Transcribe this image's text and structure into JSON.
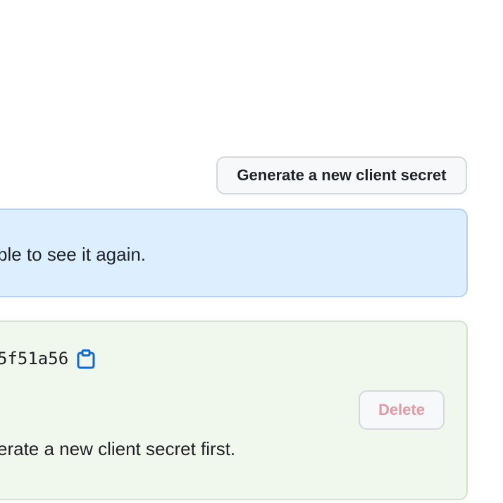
{
  "toolbar": {
    "generate_label": "Generate a new client secret"
  },
  "flash": {
    "message": "ble to see it again."
  },
  "secret": {
    "value_tail": "5f51a56",
    "copy_icon": "clipboard-icon",
    "delete_label": "Delete",
    "delete_note": "erate a new client secret first."
  },
  "colors": {
    "info_bg": "#ddeeff",
    "info_border": "#b6d2ee",
    "success_bg": "#f0f7ec",
    "success_border": "#d3e3cf",
    "accent_blue": "#0969da",
    "danger_disabled": "#e39aa3"
  }
}
